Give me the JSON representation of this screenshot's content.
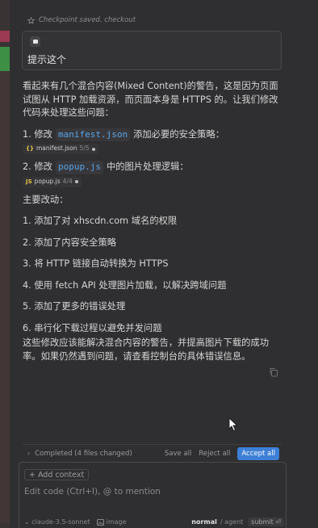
{
  "checkpoint": {
    "text": "Checkpoint saved. checkout"
  },
  "user_message": {
    "text": "提示这个"
  },
  "assistant": {
    "intro": "看起来有几个混合内容(Mixed Content)的警告，这是因为页面试图从 HTTP 加载资源，而页面本身是 HTTPS 的。让我们修改代码来处理这些问题：",
    "steps": [
      {
        "prefix": "1. 修改",
        "code": "manifest.json",
        "suffix": "添加必要的安全策略：",
        "chip": {
          "badge": "{}",
          "badge_color": "#e8c547",
          "file": "manifest.json",
          "count": "5/5"
        }
      },
      {
        "prefix": "2. 修改",
        "code": "popup.js",
        "suffix": "中的图片处理逻辑：",
        "chip": {
          "badge": "JS",
          "badge_color": "#e8c547",
          "file": "popup.js",
          "count": "4/4"
        }
      }
    ],
    "changes_heading": "主要改动：",
    "changes": [
      "1. 添加了对 xhscdn.com 域名的权限",
      "2. 添加了内容安全策略",
      "3. 将 HTTP 链接自动转换为 HTTPS",
      "4. 使用 fetch API 处理图片加载，以解决跨域问题",
      "5. 添加了更多的错误处理",
      "6. 串行化下载过程以避免并发问题"
    ],
    "conclusion": "这些修改应该能解决混合内容的警告，并提高图片下载的成功率。如果仍然遇到问题，请查看控制台的具体错误信息。"
  },
  "completed_bar": {
    "label": "Completed (4 files changed)",
    "save_all": "Save all",
    "reject_all": "Reject all",
    "accept_all": "Accept all"
  },
  "composer": {
    "add_context": "Add context",
    "placeholder": "Edit code (Ctrl+I), @ to mention",
    "model": "claude-3.5-sonnet",
    "image": "image",
    "mode_normal": "normal",
    "mode_agent": "agent",
    "submit": "submit"
  },
  "colors": {
    "accent": "#3d7fd6",
    "code": "#5aa5e8"
  },
  "icons": [
    "star-icon",
    "copy-icon",
    "chevron-right-icon",
    "image-icon",
    "cursor-icon"
  ]
}
